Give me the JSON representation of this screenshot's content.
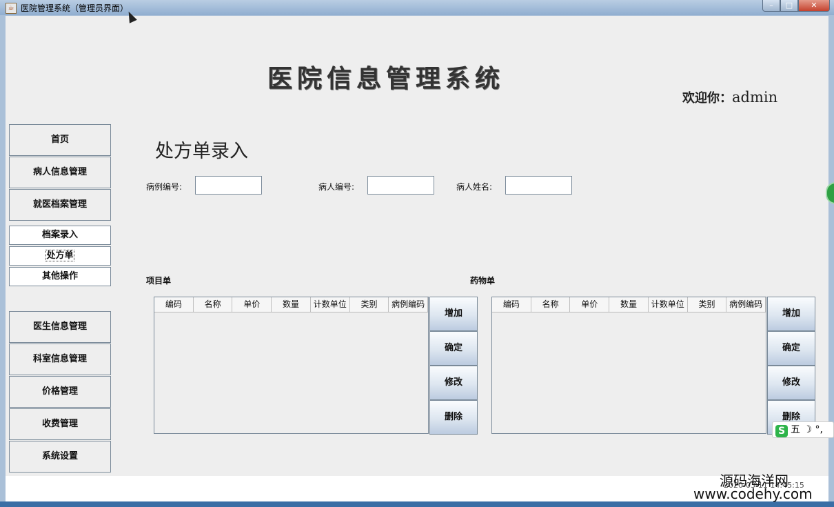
{
  "window": {
    "title": "医院管理系统（管理员界面）",
    "app_icon": "java-icon"
  },
  "header": {
    "system_title": "医院信息管理系统",
    "welcome_prefix": "欢迎你：",
    "username": "admin"
  },
  "sidebar": {
    "top_items": [
      "首页",
      "病人信息管理",
      "就医档案管理"
    ],
    "sub_items": [
      "档案录入",
      "处方单",
      "其他操作"
    ],
    "bottom_items": [
      "医生信息管理",
      "科室信息管理",
      "价格管理",
      "收费管理",
      "系统设置"
    ]
  },
  "page": {
    "heading": "处方单录入",
    "case_no_label": "病例编号:",
    "patient_no_label": "病人编号:",
    "patient_name_label": "病人姓名:",
    "case_no_value": "",
    "patient_no_value": "",
    "patient_name_value": ""
  },
  "item_table": {
    "title": "项目单",
    "columns": [
      "编码",
      "名称",
      "单价",
      "数量",
      "计数单位",
      "类别",
      "病例编码"
    ]
  },
  "drug_table": {
    "title": "药物单",
    "columns": [
      "编码",
      "名称",
      "单价",
      "数量",
      "计数单位",
      "类别",
      "病例编码"
    ]
  },
  "actions": {
    "add": "增加",
    "confirm": "确定",
    "modify": "修改",
    "delete": "删除"
  },
  "status": {
    "clock": "2020-03-11 14:45:15"
  },
  "ime": {
    "logo": "S",
    "text": "五 ☽ °,"
  },
  "watermark": {
    "line1": "源码海洋网",
    "line2": "www.codehy.com"
  }
}
